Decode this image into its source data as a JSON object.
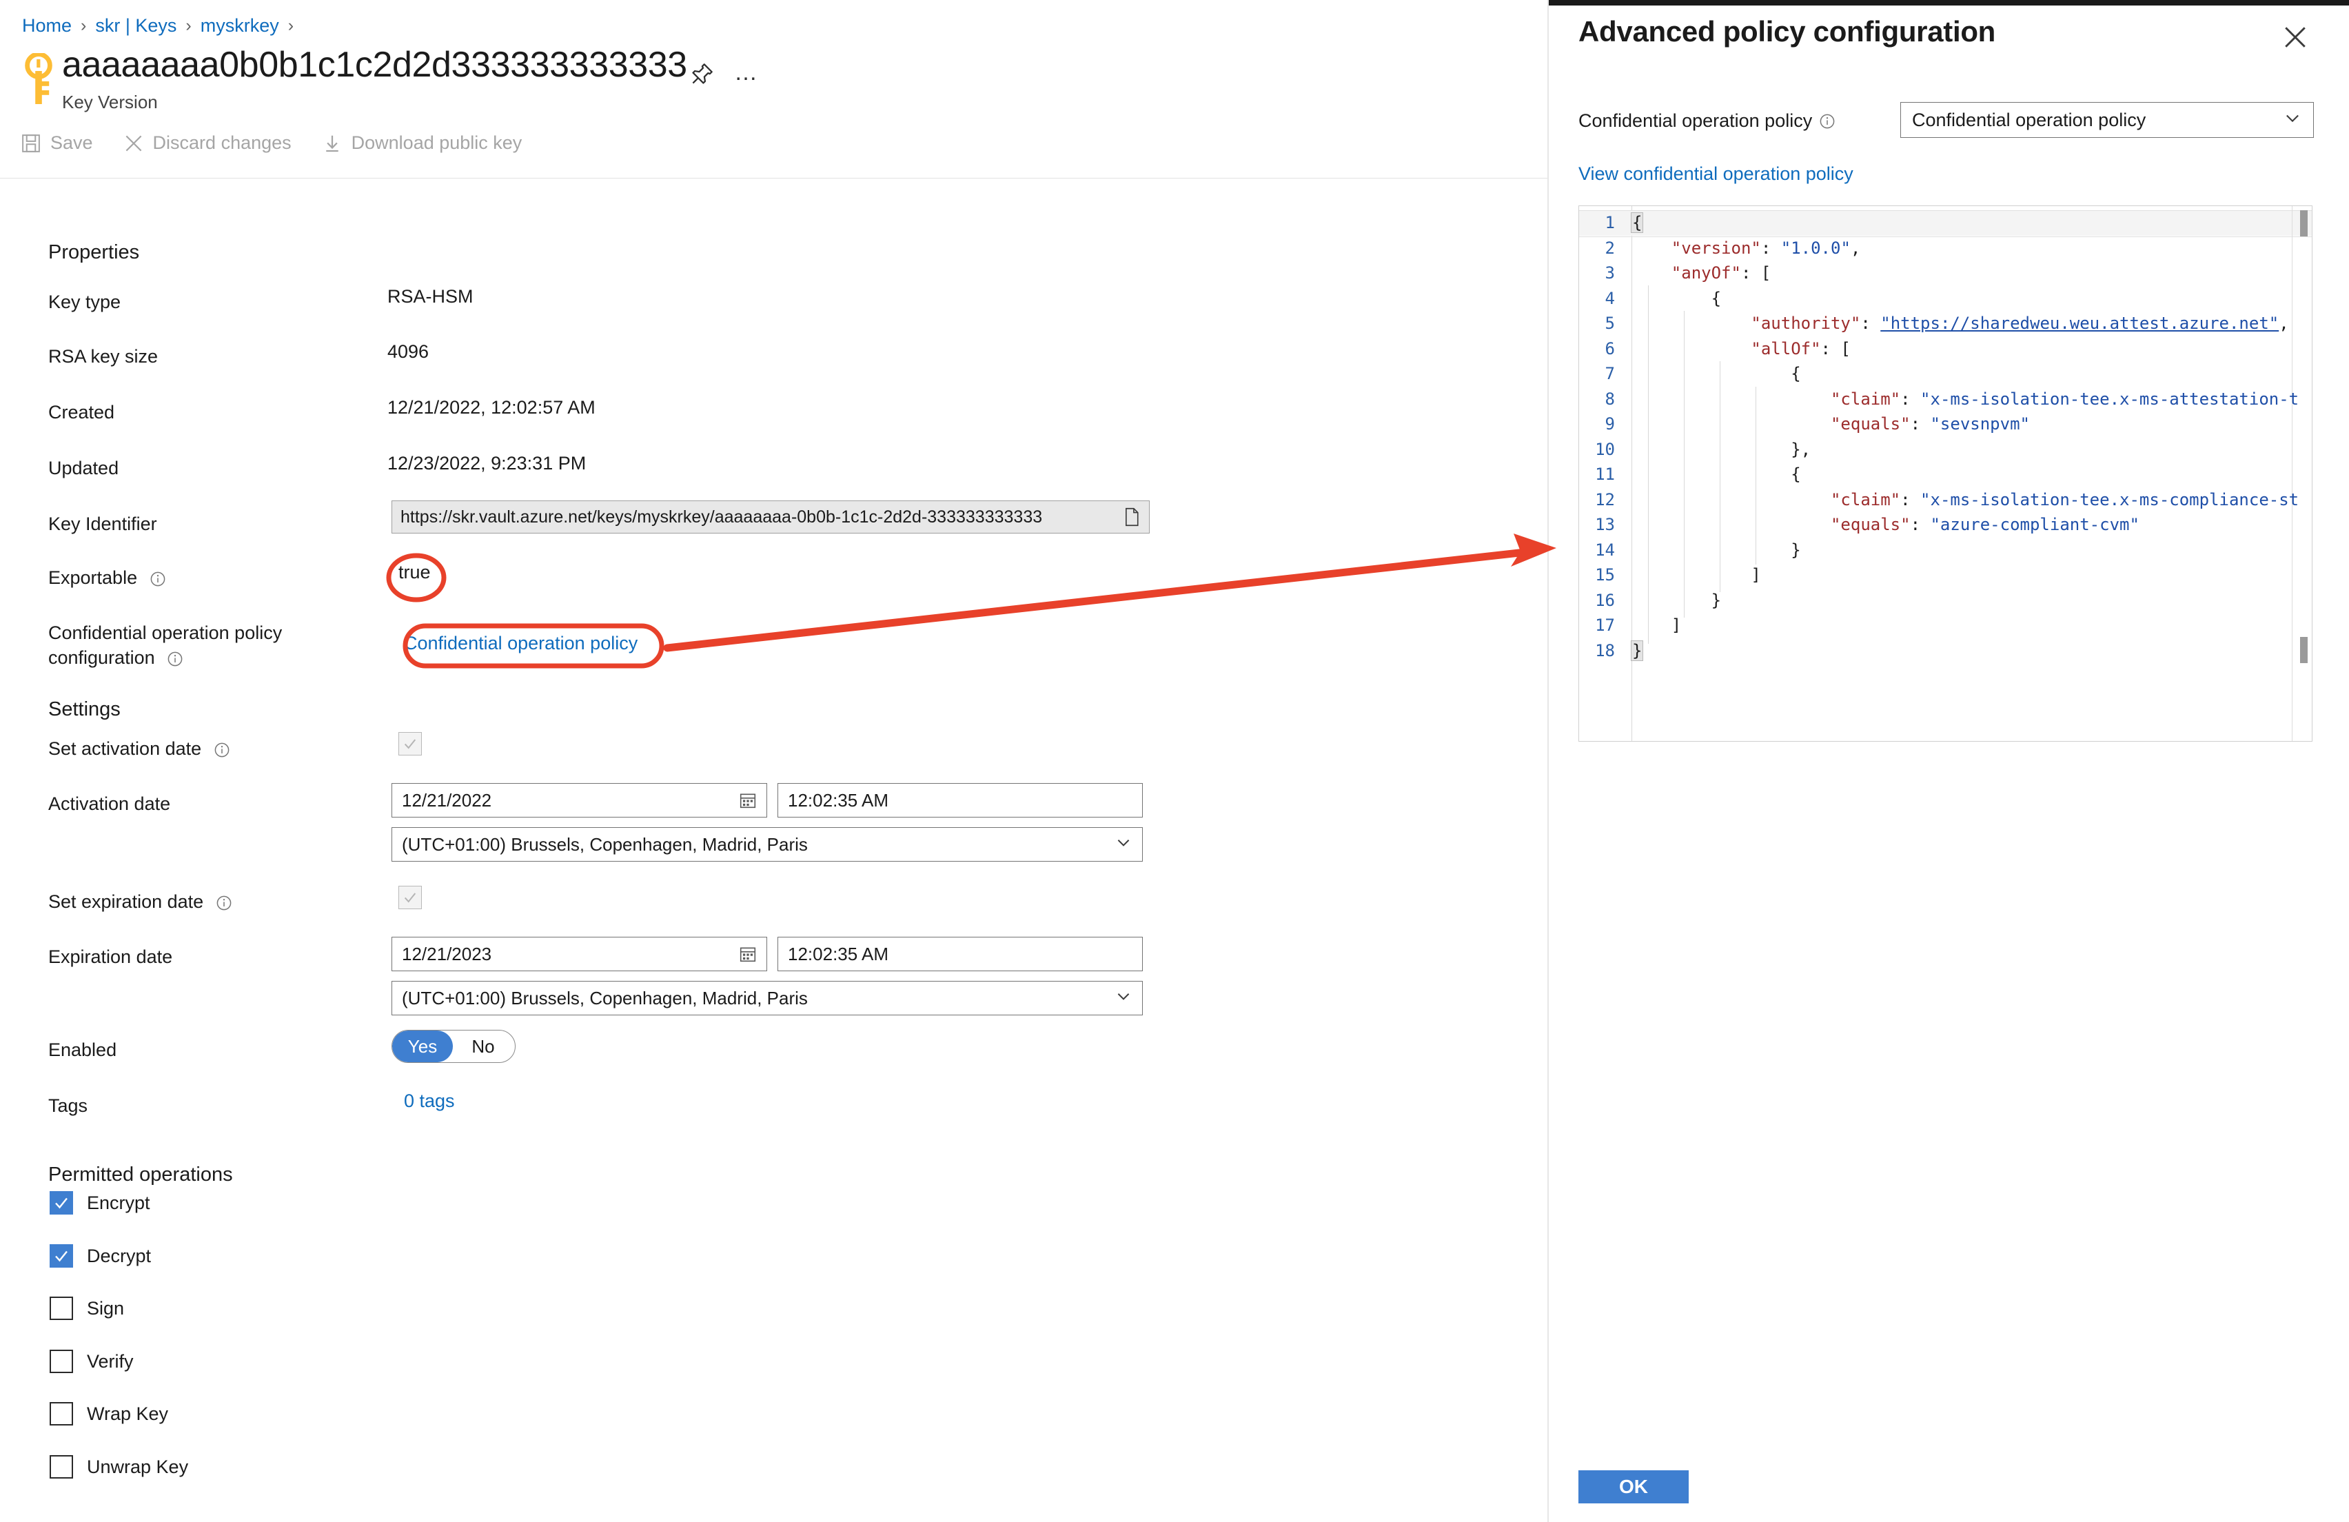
{
  "breadcrumb": {
    "items": [
      "Home",
      "skr | Keys",
      "myskrkey"
    ],
    "separator": "›"
  },
  "header": {
    "title": "aaaaaaaa0b0b1c1c2d2d333333333333",
    "subtitle": "Key Version",
    "pin_icon": "pin-icon",
    "more_label": "…"
  },
  "toolbar": {
    "save_label": "Save",
    "discard_label": "Discard changes",
    "download_label": "Download public key"
  },
  "properties": {
    "heading": "Properties",
    "key_type_label": "Key type",
    "key_type_value": "RSA-HSM",
    "rsa_key_size_label": "RSA key size",
    "rsa_key_size_value": "4096",
    "created_label": "Created",
    "created_value": "12/21/2022, 12:02:57 AM",
    "updated_label": "Updated",
    "updated_value": "12/23/2022, 9:23:31 PM",
    "key_identifier_label": "Key Identifier",
    "key_identifier_value": "https://skr.vault.azure.net/keys/myskrkey/aaaaaaaa-0b0b-1c1c-2d2d-333333333333",
    "copy_icon": "copy-icon",
    "exportable_label": "Exportable",
    "exportable_value": "true",
    "confidential_policy_label_line1": "Confidential operation policy",
    "confidential_policy_label_line2": "configuration",
    "confidential_policy_link": "Confidential operation policy"
  },
  "settings": {
    "heading": "Settings",
    "set_activation_date_label": "Set activation date",
    "activation_date_label": "Activation date",
    "activation_date_value": "12/21/2022",
    "activation_time_value": "12:02:35 AM",
    "activation_timezone_value": "(UTC+01:00) Brussels, Copenhagen, Madrid, Paris",
    "set_expiration_date_label": "Set expiration date",
    "expiration_date_label": "Expiration date",
    "expiration_date_value": "12/21/2023",
    "expiration_time_value": "12:02:35 AM",
    "expiration_timezone_value": "(UTC+01:00) Brussels, Copenhagen, Madrid, Paris",
    "enabled_label": "Enabled",
    "enabled_yes": "Yes",
    "enabled_no": "No",
    "tags_label": "Tags",
    "tags_value": "0 tags",
    "calendar_icon": "calendar-icon",
    "chevron_icon": "chevron-down-icon"
  },
  "permitted_operations": {
    "heading": "Permitted operations",
    "items": [
      {
        "label": "Encrypt",
        "checked": true
      },
      {
        "label": "Decrypt",
        "checked": true
      },
      {
        "label": "Sign",
        "checked": false
      },
      {
        "label": "Verify",
        "checked": false
      },
      {
        "label": "Wrap Key",
        "checked": false
      },
      {
        "label": "Unwrap Key",
        "checked": false
      }
    ]
  },
  "panel": {
    "title": "Advanced policy configuration",
    "close_icon": "close-icon",
    "policy_label": "Confidential operation policy",
    "policy_select_value": "Confidential operation policy",
    "view_policy_link": "View confidential operation policy",
    "ok_label": "OK",
    "editor": {
      "line_count": 18,
      "lines": [
        {
          "n": 1,
          "text": "{"
        },
        {
          "n": 2,
          "text": "    \"version\": \"1.0.0\","
        },
        {
          "n": 3,
          "text": "    \"anyOf\": ["
        },
        {
          "n": 4,
          "text": "        {"
        },
        {
          "n": 5,
          "text": "            \"authority\": \"https://sharedweu.weu.attest.azure.net\","
        },
        {
          "n": 6,
          "text": "            \"allOf\": ["
        },
        {
          "n": 7,
          "text": "                {"
        },
        {
          "n": 8,
          "text": "                    \"claim\": \"x-ms-isolation-tee.x-ms-attestation-t"
        },
        {
          "n": 9,
          "text": "                    \"equals\": \"sevsnpvm\""
        },
        {
          "n": 10,
          "text": "                },"
        },
        {
          "n": 11,
          "text": "                {"
        },
        {
          "n": 12,
          "text": "                    \"claim\": \"x-ms-isolation-tee.x-ms-compliance-st"
        },
        {
          "n": 13,
          "text": "                    \"equals\": \"azure-compliant-cvm\""
        },
        {
          "n": 14,
          "text": "                }"
        },
        {
          "n": 15,
          "text": "            ]"
        },
        {
          "n": 16,
          "text": "        }"
        },
        {
          "n": 17,
          "text": "    ]"
        },
        {
          "n": 18,
          "text": "}"
        }
      ]
    }
  },
  "annotations": {
    "highlight_exportable": "true",
    "highlight_policy_link": "Confidential operation policy",
    "arrow_color": "#e8412a"
  },
  "colors": {
    "link": "#0f6cbd",
    "accent": "#3f7fd0",
    "annotation_red": "#e8412a",
    "key_icon_yellow": "#fdbd35",
    "text": "#1b1b1b",
    "disabled_text": "#a5a5a5"
  }
}
